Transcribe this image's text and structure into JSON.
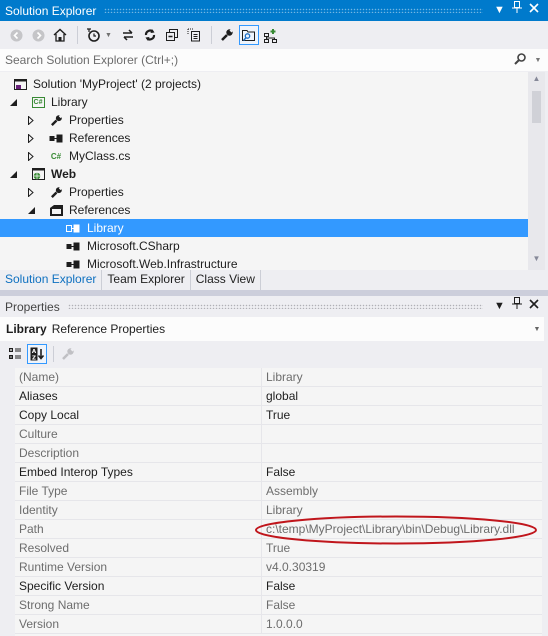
{
  "solution_explorer": {
    "title": "Solution Explorer",
    "title_buttons": [
      "dropdown-icon",
      "pin-icon",
      "close-icon"
    ],
    "toolbar": {
      "buttons": [
        {
          "name": "back",
          "icon": "back-icon",
          "enabled": false
        },
        {
          "name": "forward",
          "icon": "forward-icon",
          "enabled": false
        },
        {
          "name": "home",
          "icon": "home-icon",
          "enabled": true
        },
        {
          "name": "pending-changes-filter",
          "icon": "clock-filter-icon",
          "enabled": true
        },
        {
          "name": "sync-with-active-document",
          "icon": "sync-icon",
          "enabled": true
        },
        {
          "name": "refresh",
          "icon": "refresh-icon",
          "enabled": true
        },
        {
          "name": "collapse-all",
          "icon": "collapse-all-icon",
          "enabled": true
        },
        {
          "name": "show-all-files",
          "icon": "show-all-files-icon",
          "enabled": true
        },
        {
          "name": "properties",
          "icon": "wrench-icon",
          "enabled": true
        },
        {
          "name": "preview-selected-items",
          "icon": "preview-icon",
          "enabled": true,
          "selected": true
        },
        {
          "name": "view-class-diagram",
          "icon": "class-diagram-icon",
          "enabled": true
        }
      ]
    },
    "search": {
      "placeholder": "Search Solution Explorer (Ctrl+;)"
    },
    "tree": [
      {
        "label": "Solution 'MyProject' (2 projects)",
        "level": 0,
        "icon": "solution-icon",
        "expander": "none"
      },
      {
        "label": "Library",
        "level": 0,
        "icon": "csharp-project-icon",
        "expander": "expanded"
      },
      {
        "label": "Properties",
        "level": 1,
        "icon": "wrench-icon",
        "expander": "collapsed"
      },
      {
        "label": "References",
        "level": 1,
        "icon": "references-icon",
        "expander": "collapsed"
      },
      {
        "label": "MyClass.cs",
        "level": 1,
        "icon": "csharp-file-icon",
        "expander": "collapsed"
      },
      {
        "label": "Web",
        "level": 0,
        "icon": "web-project-icon",
        "expander": "expanded",
        "bold": true
      },
      {
        "label": "Properties",
        "level": 1,
        "icon": "wrench-icon",
        "expander": "collapsed"
      },
      {
        "label": "References",
        "level": 1,
        "icon": "references-folder-icon",
        "expander": "expanded"
      },
      {
        "label": "Library",
        "level": 2,
        "icon": "reference-icon",
        "expander": "none",
        "selected": true
      },
      {
        "label": "Microsoft.CSharp",
        "level": 2,
        "icon": "reference-icon",
        "expander": "none"
      },
      {
        "label": "Microsoft.Web.Infrastructure",
        "level": 2,
        "icon": "reference-icon",
        "expander": "none"
      }
    ],
    "tabs": [
      {
        "label": "Solution Explorer",
        "active": true
      },
      {
        "label": "Team Explorer",
        "active": false
      },
      {
        "label": "Class View",
        "active": false
      }
    ]
  },
  "properties": {
    "title": "Properties",
    "object_name": "Library",
    "object_type": "Reference Properties",
    "toolbar": [
      {
        "name": "categorized",
        "icon": "categorized-icon",
        "selected": false
      },
      {
        "name": "alphabetical",
        "icon": "alphabetical-sort-icon",
        "selected": true
      },
      {
        "name": "property-pages",
        "icon": "wrench-icon",
        "enabled": false
      }
    ],
    "rows": [
      {
        "name": "(Name)",
        "value": "Library",
        "editable": false
      },
      {
        "name": "Aliases",
        "value": "global",
        "editable": true
      },
      {
        "name": "Copy Local",
        "value": "True",
        "editable": true
      },
      {
        "name": "Culture",
        "value": "",
        "editable": false
      },
      {
        "name": "Description",
        "value": "",
        "editable": false
      },
      {
        "name": "Embed Interop Types",
        "value": "False",
        "editable": true
      },
      {
        "name": "File Type",
        "value": "Assembly",
        "editable": false
      },
      {
        "name": "Identity",
        "value": "Library",
        "editable": false
      },
      {
        "name": "Path",
        "value": "c:\\temp\\MyProject\\Library\\bin\\Debug\\Library.dll",
        "editable": false,
        "annotated": true
      },
      {
        "name": "Resolved",
        "value": "True",
        "editable": false
      },
      {
        "name": "Runtime Version",
        "value": "v4.0.30319",
        "editable": false
      },
      {
        "name": "Specific Version",
        "value": "False",
        "editable": true
      },
      {
        "name": "Strong Name",
        "value": "False",
        "editable": false
      },
      {
        "name": "Version",
        "value": "1.0.0.0",
        "editable": false
      }
    ]
  },
  "colors": {
    "accent": "#007acc",
    "selection": "#3399ff",
    "annotation": "#c0161c",
    "active_tab": "#0e70c0"
  }
}
